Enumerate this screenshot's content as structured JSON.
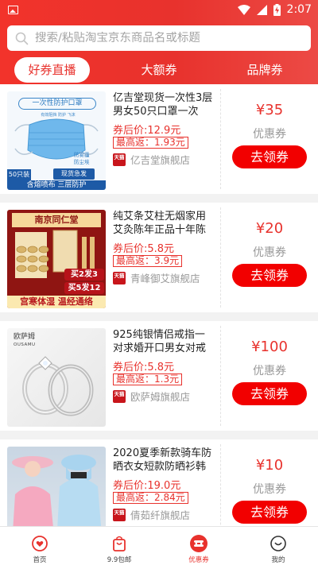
{
  "status_bar": {
    "time": "2:07"
  },
  "search": {
    "placeholder": "搜索/粘贴淘宝京东商品名或标题"
  },
  "tabs": [
    {
      "label": "好券直播",
      "active": true
    },
    {
      "label": "大额券",
      "active": false
    },
    {
      "label": "品牌券",
      "active": false
    }
  ],
  "products": [
    {
      "title": "亿吉堂现货一次性3层男女50只口罩一次性...",
      "price": "券后价:12.9元",
      "rebate": "最高返：1.93元",
      "shop_badge": "天猫",
      "shop": "亿吉堂旗舰店",
      "coupon_amount": "¥35",
      "coupon_label": "优惠券",
      "button": "去领券",
      "thumb_texts": {
        "banner": "一次性防护口罩",
        "corner": "50只装",
        "badge": "现货急发",
        "footer": "含熔喷布 三层防护",
        "tag1": "防雾霾",
        "tag2": "防尘埃",
        "small": "有效阻挡 防护 飞沫"
      }
    },
    {
      "title": "纯艾条艾柱无烟家用艾灸陈年正品十年陈艾...",
      "price": "券后价:5.8元",
      "rebate": "最高返：3.9元",
      "shop_badge": "天猫",
      "shop": "青峰御艾旗舰店",
      "coupon_amount": "¥20",
      "coupon_label": "优惠券",
      "button": "去领券",
      "thumb_texts": {
        "banner": "南京同仁堂",
        "promo1": "买2发3",
        "promo2": "买5发12",
        "footer": "宫寒体湿 温经通络"
      }
    },
    {
      "title": "925纯银情侣戒指一对求婚开口男女对戒日...",
      "price": "券后价:5.8元",
      "rebate": "最高返：1.3元",
      "shop_badge": "天猫",
      "shop": "欧萨姆旗舰店",
      "coupon_amount": "¥100",
      "coupon_label": "优惠券",
      "button": "去领券",
      "thumb_texts": {
        "brand_cn": "欧萨姆",
        "brand_en": "OUSAMU"
      }
    },
    {
      "title": "2020夏季新款骑车防晒衣女短款防晒衫韩版...",
      "price": "券后价:19.0元",
      "rebate": "最高返：2.84元",
      "shop_badge": "天猫",
      "shop": "倩茹纤旗舰店",
      "coupon_amount": "¥10",
      "coupon_label": "优惠券",
      "button": "去领券",
      "thumb_texts": {}
    }
  ],
  "bottom_nav": [
    {
      "label": "首页",
      "icon": "home-icon",
      "active": false
    },
    {
      "label": "9.9包邮",
      "icon": "bag-icon",
      "active": false
    },
    {
      "label": "优惠券",
      "icon": "coupon-icon",
      "active": true
    },
    {
      "label": "我的",
      "icon": "profile-icon",
      "active": false
    }
  ],
  "colors": {
    "brand_red": "#e8322d",
    "button_red": "#f20000",
    "price_red": "#e8322d"
  }
}
